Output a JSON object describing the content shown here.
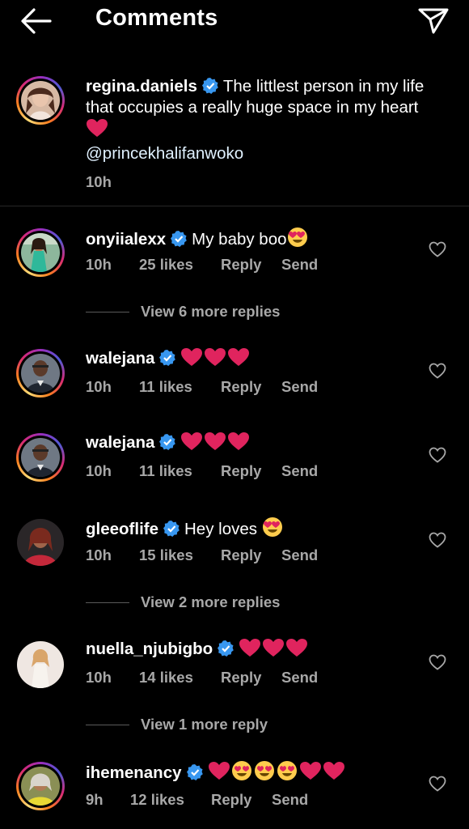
{
  "header": {
    "title": "Comments",
    "back_icon": "back-arrow-icon",
    "share_icon": "paper-plane-icon"
  },
  "caption": {
    "username": "regina.daniels",
    "text": "The littlest person in my life that occupies a really huge space in my heart",
    "mention": "@princekhalifanwoko",
    "time": "10h"
  },
  "comments": [
    {
      "username": "onyiialexx",
      "text": "My baby boo",
      "time": "10h",
      "likes": "25 likes",
      "reply": "Reply",
      "send": "Send",
      "view_more": "View 6 more replies"
    },
    {
      "username": "walejana",
      "text": "",
      "time": "10h",
      "likes": "11 likes",
      "reply": "Reply",
      "send": "Send"
    },
    {
      "username": "walejana",
      "text": "",
      "time": "10h",
      "likes": "11 likes",
      "reply": "Reply",
      "send": "Send"
    },
    {
      "username": "gleeoflife",
      "text": "Hey loves",
      "time": "10h",
      "likes": "15 likes",
      "reply": "Reply",
      "send": "Send",
      "view_more": "View 2 more replies"
    },
    {
      "username": "nuella_njubigbo",
      "text": "",
      "time": "10h",
      "likes": "14 likes",
      "reply": "Reply",
      "send": "Send",
      "view_more": "View 1 more reply"
    },
    {
      "username": "ihemenancy",
      "text": "",
      "time": "9h",
      "likes": "12 likes",
      "reply": "Reply",
      "send": "Send"
    }
  ],
  "colors": {
    "background": "#000000",
    "meta": "#a8a8a8",
    "verified": "#3897f0",
    "heart_emoji": "#e0245e"
  }
}
